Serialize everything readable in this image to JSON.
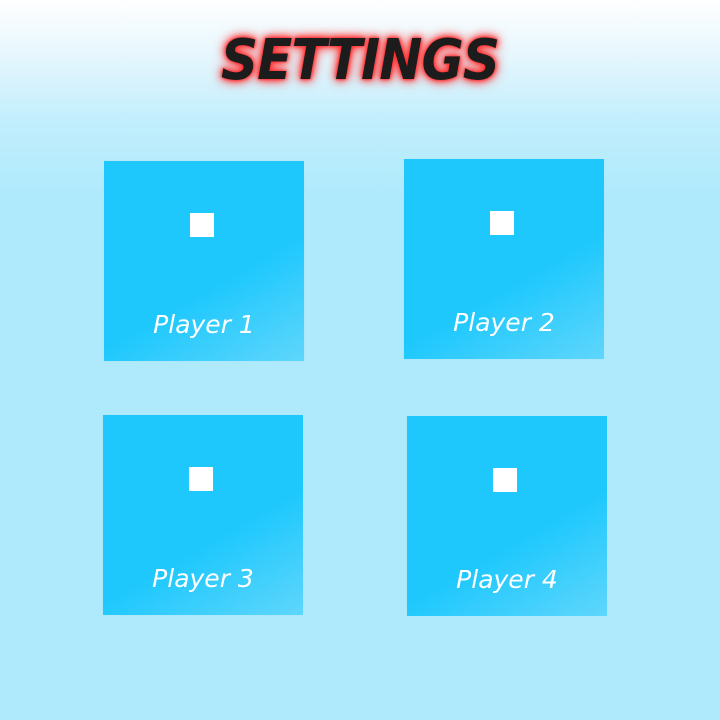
{
  "title": "SETTINGS",
  "players": [
    {
      "label": "Player 1"
    },
    {
      "label": "Player 2"
    },
    {
      "label": "Player 3"
    },
    {
      "label": "Player 4"
    }
  ],
  "colors": {
    "tile": "#1ec8fd",
    "background": "#aeeafc",
    "title_text": "#1c1c1c",
    "title_glow": "#ff2a2a",
    "marker": "#ffffff",
    "label": "#ffffff"
  }
}
